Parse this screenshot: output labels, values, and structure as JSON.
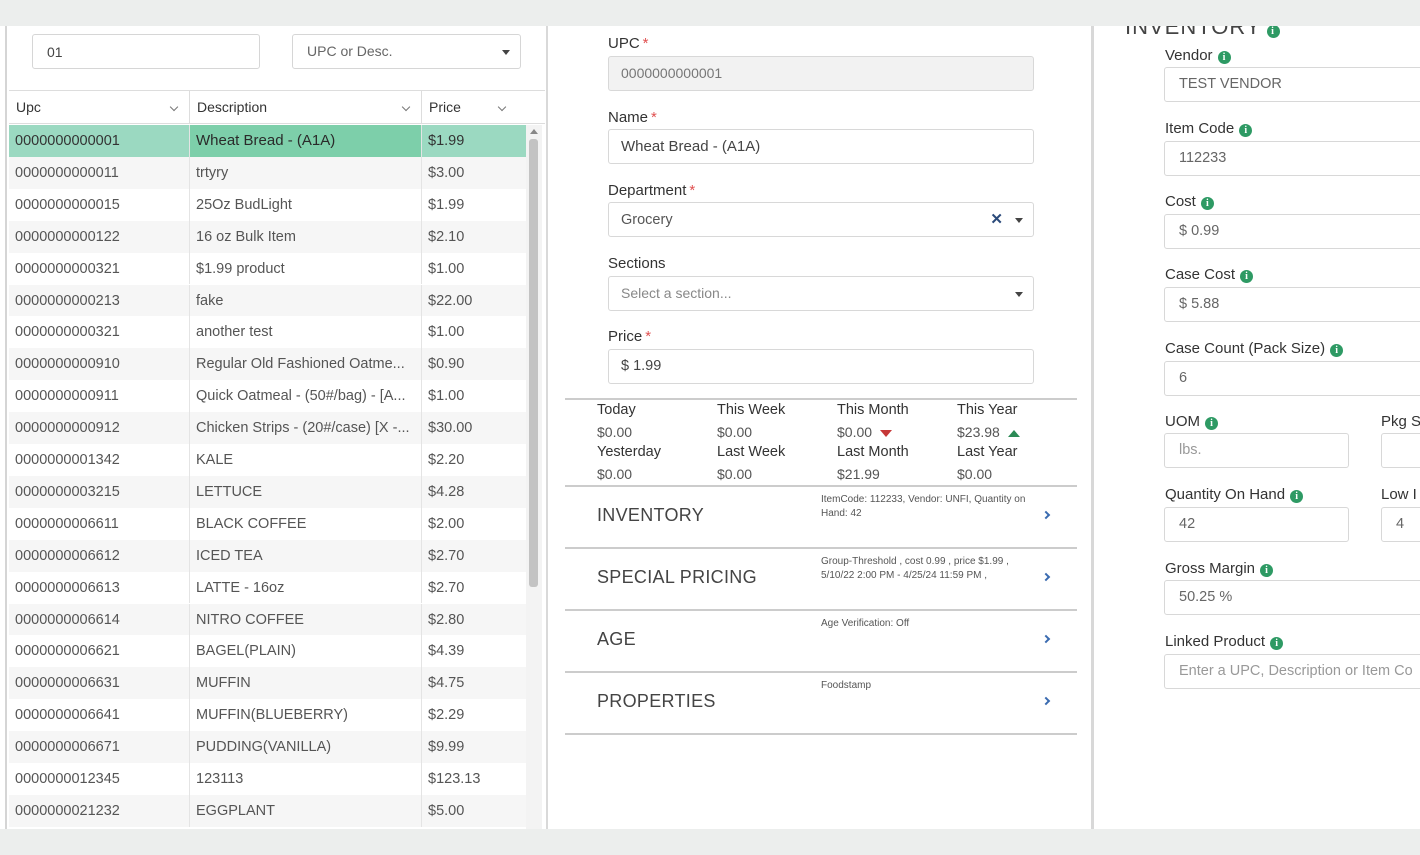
{
  "search": {
    "value": "01",
    "type_label": "UPC or Desc."
  },
  "grid": {
    "columns": [
      "Upc",
      "Description",
      "Price"
    ],
    "rows": [
      {
        "upc": "0000000000001",
        "desc": "Wheat Bread - (A1A)",
        "price": "$1.99",
        "selected": true
      },
      {
        "upc": "0000000000011",
        "desc": "trtyry",
        "price": "$3.00"
      },
      {
        "upc": "0000000000015",
        "desc": "25Oz BudLight",
        "price": "$1.99"
      },
      {
        "upc": "0000000000122",
        "desc": "16 oz Bulk Item",
        "price": "$2.10"
      },
      {
        "upc": "0000000000321",
        "desc": "$1.99 product",
        "price": "$1.00"
      },
      {
        "upc": "0000000000213",
        "desc": "fake",
        "price": "$22.00"
      },
      {
        "upc": "0000000000321",
        "desc": "another test",
        "price": "$1.00"
      },
      {
        "upc": "0000000000910",
        "desc": "Regular Old Fashioned Oatme...",
        "price": "$0.90"
      },
      {
        "upc": "0000000000911",
        "desc": "Quick Oatmeal - (50#/bag) - [A...",
        "price": "$1.00"
      },
      {
        "upc": "0000000000912",
        "desc": "Chicken Strips - (20#/case) [X -...",
        "price": "$30.00"
      },
      {
        "upc": "0000000001342",
        "desc": "KALE",
        "price": "$2.20"
      },
      {
        "upc": "0000000003215",
        "desc": "LETTUCE",
        "price": "$4.28"
      },
      {
        "upc": "0000000006611",
        "desc": "BLACK COFFEE",
        "price": "$2.00"
      },
      {
        "upc": "0000000006612",
        "desc": "ICED TEA",
        "price": "$2.70"
      },
      {
        "upc": "0000000006613",
        "desc": "LATTE - 16oz",
        "price": "$2.70"
      },
      {
        "upc": "0000000006614",
        "desc": "NITRO COFFEE",
        "price": "$2.80"
      },
      {
        "upc": "0000000006621",
        "desc": "BAGEL(PLAIN)",
        "price": "$4.39"
      },
      {
        "upc": "0000000006631",
        "desc": "MUFFIN",
        "price": "$4.75"
      },
      {
        "upc": "0000000006641",
        "desc": "MUFFIN(BLUEBERRY)",
        "price": "$2.29"
      },
      {
        "upc": "0000000006671",
        "desc": "PUDDING(VANILLA)",
        "price": "$9.99"
      },
      {
        "upc": "0000000012345",
        "desc": "123113",
        "price": "$123.13"
      },
      {
        "upc": "0000000021232",
        "desc": "EGGPLANT",
        "price": "$5.00"
      }
    ]
  },
  "form": {
    "upc_label": "UPC",
    "upc_value": "0000000000001",
    "name_label": "Name",
    "name_value": "Wheat Bread - (A1A)",
    "department_label": "Department",
    "department_value": "Grocery",
    "sections_label": "Sections",
    "sections_placeholder": "Select a section...",
    "price_label": "Price",
    "price_value": "$ 1.99",
    "required_mark": "*"
  },
  "stats": {
    "today_label": "Today",
    "today_value": "$0.00",
    "week_label": "This Week",
    "week_value": "$0.00",
    "month_label": "This Month",
    "month_value": "$0.00",
    "year_label": "This Year",
    "year_value": "$23.98",
    "yesterday_label": "Yesterday",
    "yesterday_value": "$0.00",
    "lastweek_label": "Last Week",
    "lastweek_value": "$0.00",
    "lastmonth_label": "Last Month",
    "lastmonth_value": "$21.99",
    "lastyear_label": "Last Year",
    "lastyear_value": "$0.00"
  },
  "sections": [
    {
      "title": "INVENTORY",
      "desc": "ItemCode: 112233, Vendor: UNFI, Quantity on Hand: 42"
    },
    {
      "title": "SPECIAL PRICING",
      "desc": "Group-Threshold , cost 0.99 , price $1.99 , 5/10/22 2:00 PM - 4/25/24 11:59 PM ,"
    },
    {
      "title": "AGE",
      "desc": "Age Verification: Off"
    },
    {
      "title": "PROPERTIES",
      "desc": "Foodstamp"
    }
  ],
  "inventory": {
    "heading": "INVENTORY",
    "info_glyph": "i",
    "vendor_label": "Vendor",
    "vendor_value": "TEST VENDOR",
    "itemcode_label": "Item Code",
    "itemcode_value": "112233",
    "cost_label": "Cost",
    "cost_value": "$ 0.99",
    "casecost_label": "Case Cost",
    "casecost_value": "$ 5.88",
    "casecount_label": "Case Count (Pack Size)",
    "casecount_value": "6",
    "uom_label": "UOM",
    "uom_placeholder": "lbs.",
    "pkg_label": "Pkg Si",
    "qoh_label": "Quantity On Hand",
    "qoh_value": "42",
    "low_label": "Low I",
    "low_value": "4",
    "margin_label": "Gross Margin",
    "margin_value": "50.25 %",
    "linked_label": "Linked Product",
    "linked_placeholder": "Enter a UPC, Description or Item Co"
  },
  "colors": {
    "selected_row": "#9bd9c1",
    "selected_cell": "#7dcfaa",
    "info_green": "#2e9a64",
    "required_red": "#e05050",
    "down_red": "#c63838",
    "up_green": "#2b8a55"
  }
}
